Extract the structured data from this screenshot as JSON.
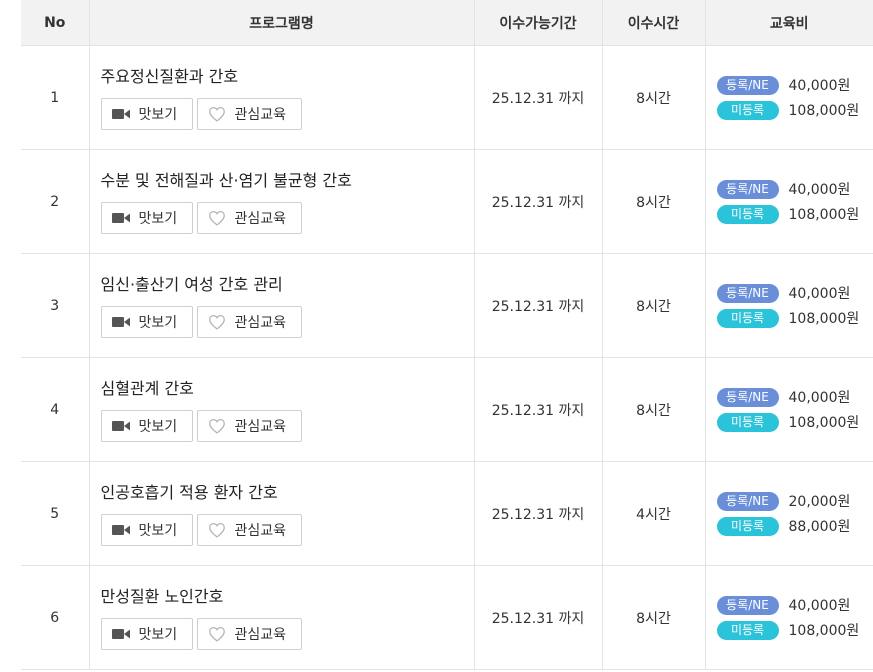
{
  "header": {
    "no": "No",
    "program": "프로그램명",
    "period": "이수가능기간",
    "hours": "이수시간",
    "fee": "교육비"
  },
  "labels": {
    "preview": "맛보기",
    "wishlist": "관심교육",
    "registered": "등록/NE",
    "unregistered": "미등록"
  },
  "icons": {
    "preview": "video-camera-icon",
    "wishlist": "heart-outline-icon"
  },
  "colors": {
    "registered_badge": "#6a8fd8",
    "unregistered_badge": "#2bc3d9",
    "header_bg": "#f2f2f2"
  },
  "rows": [
    {
      "no": "1",
      "title": "주요정신질환과 간호",
      "period": "25.12.31 까지",
      "hours": "8시간",
      "fee_reg": "40,000원",
      "fee_unreg": "108,000원"
    },
    {
      "no": "2",
      "title": "수분 및 전해질과 산·염기 불균형 간호",
      "period": "25.12.31 까지",
      "hours": "8시간",
      "fee_reg": "40,000원",
      "fee_unreg": "108,000원"
    },
    {
      "no": "3",
      "title": "임신·출산기 여성 간호 관리",
      "period": "25.12.31 까지",
      "hours": "8시간",
      "fee_reg": "40,000원",
      "fee_unreg": "108,000원"
    },
    {
      "no": "4",
      "title": "심혈관계 간호",
      "period": "25.12.31 까지",
      "hours": "8시간",
      "fee_reg": "40,000원",
      "fee_unreg": "108,000원"
    },
    {
      "no": "5",
      "title": "인공호흡기 적용 환자 간호",
      "period": "25.12.31 까지",
      "hours": "4시간",
      "fee_reg": "20,000원",
      "fee_unreg": "88,000원"
    },
    {
      "no": "6",
      "title": "만성질환 노인간호",
      "period": "25.12.31 까지",
      "hours": "8시간",
      "fee_reg": "40,000원",
      "fee_unreg": "108,000원"
    }
  ]
}
